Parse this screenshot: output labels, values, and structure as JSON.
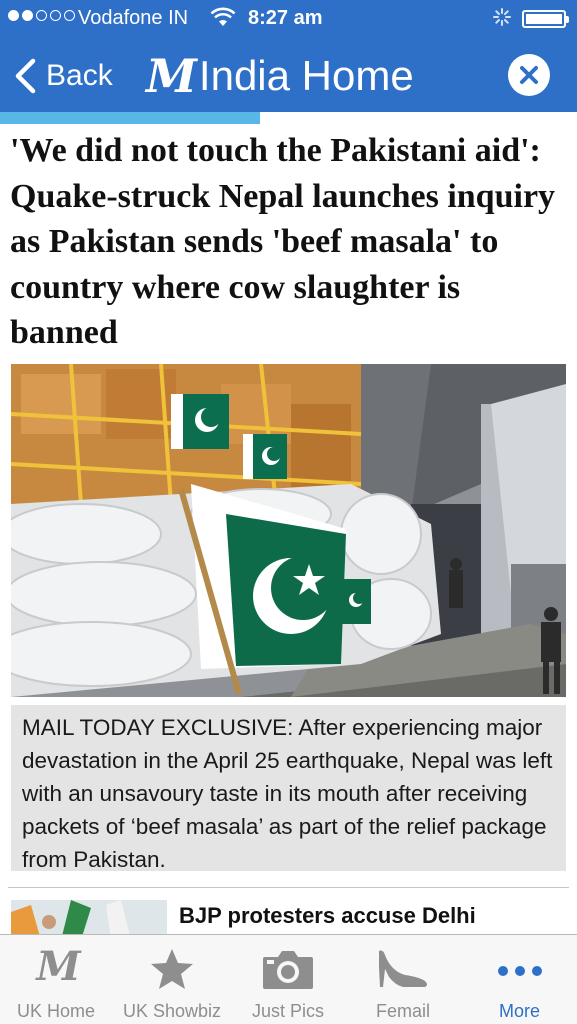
{
  "status_bar": {
    "carrier": "Vodafone IN",
    "time": "8:27 am"
  },
  "nav": {
    "back_label": "Back",
    "logo_mark": "M",
    "title": "India Home"
  },
  "reading_progress": 0.45,
  "article": {
    "headline": "'We did not touch the Pakistani aid': Quake-struck Nepal launches inquiry as Pakistan sends 'beef masala' to country where cow slaughter is banned",
    "caption": "MAIL TODAY EXCLUSIVE: After experiencing major devastation in the April 25 earthquake, Nepal was left with an unsavoury taste in its mouth after receiving packets of ‘beef masala’ as part of the relief package from Pakistan."
  },
  "related": {
    "title": "BJP protesters accuse Delhi"
  },
  "tabs": [
    {
      "label": "UK Home",
      "icon": "dailymail-logo-icon",
      "active": false
    },
    {
      "label": "UK Showbiz",
      "icon": "star-icon",
      "active": false
    },
    {
      "label": "Just Pics",
      "icon": "camera-icon",
      "active": false
    },
    {
      "label": "Femail",
      "icon": "high-heel-icon",
      "active": false
    },
    {
      "label": "More",
      "icon": "more-dots-icon",
      "active": true
    }
  ],
  "colors": {
    "brand_blue": "#2e6fc8",
    "progress": "#59b7e8",
    "caption_bg": "#e4e4e4",
    "tab_inactive": "#8e8e8e"
  }
}
